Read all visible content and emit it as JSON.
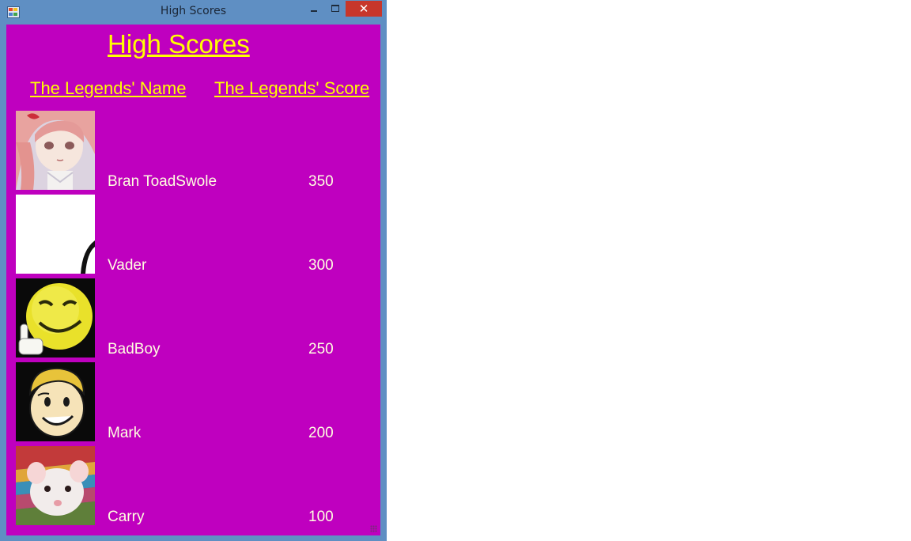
{
  "window": {
    "title": "High Scores",
    "close_glyph": "✕"
  },
  "form": {
    "heading": "High Scores",
    "name_header": "The Legends' Name",
    "score_header": "The Legends' Score"
  },
  "entries": [
    {
      "name": "Bran ToadSwole",
      "score": "350",
      "avatar": "anime-girl-avatar"
    },
    {
      "name": "Vader",
      "score": "300",
      "avatar": "white-avatar"
    },
    {
      "name": "BadBoy",
      "score": "250",
      "avatar": "smiley-avatar"
    },
    {
      "name": "Mark",
      "score": "200",
      "avatar": "vault-boy-avatar"
    },
    {
      "name": "Carry",
      "score": "100",
      "avatar": "rat-avatar"
    }
  ],
  "colors": {
    "frame": "#5f8fc3",
    "background": "#bf00bf",
    "heading": "#ffff00",
    "entry_text": "#ffffe0",
    "close_button": "#c7362b"
  }
}
